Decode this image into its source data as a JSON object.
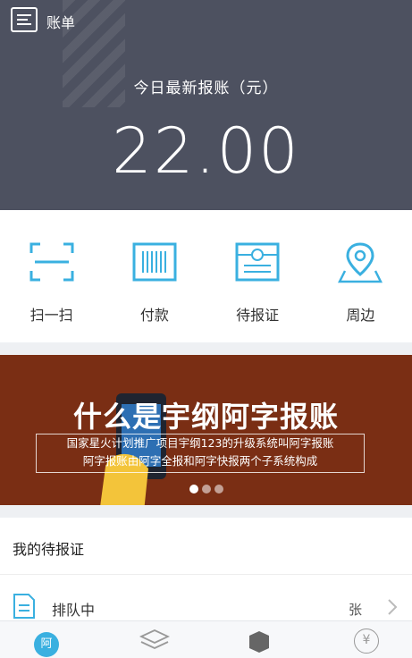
{
  "header": {
    "app_title": "账单",
    "label": "今日最新报账（元）",
    "amount": "22.00"
  },
  "actions": [
    {
      "label": "扫一扫",
      "icon": "scan-icon"
    },
    {
      "label": "付款",
      "icon": "barcode-icon"
    },
    {
      "label": "待报证",
      "icon": "receipt-icon"
    },
    {
      "label": "周边",
      "icon": "map-pin-icon"
    }
  ],
  "banner": {
    "headline": "什么是宇纲阿字报账",
    "desc_line1": "国家星火计划推广项目宇纲123的升级系统叫阿字报账",
    "desc_line2": "阿字报账由阿字全报和阿字快报两个子系统构成",
    "slide_count": 3,
    "active_slide": 1
  },
  "pending": {
    "title": "我的待报证",
    "row_label": "排队中",
    "row_unit": "张"
  },
  "bottom_nav": {
    "home_label": "阿",
    "yen_label": "¥"
  },
  "colors": {
    "header_bg": "#4d5160",
    "accent": "#3ab0e0",
    "banner_bg": "#7a2e14"
  }
}
